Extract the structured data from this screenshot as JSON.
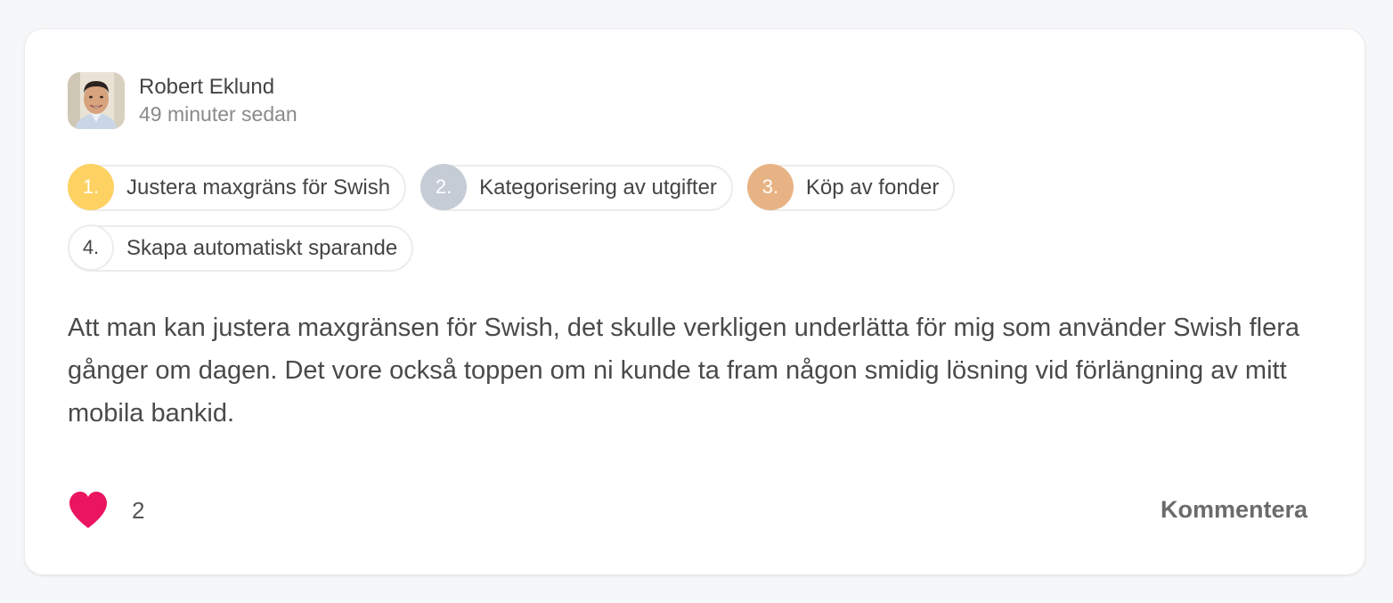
{
  "post": {
    "author": {
      "name": "Robert Eklund",
      "timestamp": "49 minuter sedan"
    },
    "tags": [
      {
        "number": "1.",
        "label": "Justera maxgräns för Swish",
        "color": "#fdd262"
      },
      {
        "number": "2.",
        "label": "Kategorisering av utgifter",
        "color": "#c5ccd6"
      },
      {
        "number": "3.",
        "label": "Köp av fonder",
        "color": "#e8b384"
      },
      {
        "number": "4.",
        "label": "Skapa automatiskt sparande",
        "color": "#ffffff"
      }
    ],
    "body": "Att man kan justera maxgränsen för Swish, det skulle verkligen underlätta för mig som använder Swish flera gånger om dagen. Det vore också toppen om ni kunde ta fram någon smidig lösning vid förlängning av mitt mobila bankid.",
    "likes": {
      "icon": "heart-icon",
      "count": "2",
      "color": "#ea1460"
    },
    "comment_label": "Kommentera"
  }
}
